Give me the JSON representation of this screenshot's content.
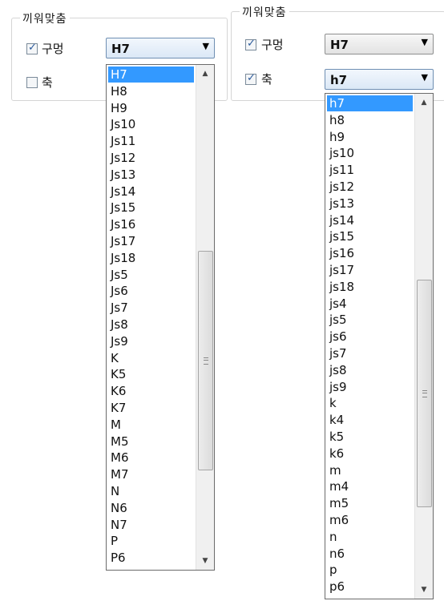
{
  "left": {
    "group_title": "끼워맞춤",
    "hole": {
      "label": "구멍",
      "checked": true
    },
    "shaft": {
      "label": "축",
      "checked": false
    },
    "combo_value": "H7",
    "items": [
      "H7",
      "H8",
      "H9",
      "Js10",
      "Js11",
      "Js12",
      "Js13",
      "Js14",
      "Js15",
      "Js16",
      "Js17",
      "Js18",
      "Js5",
      "Js6",
      "Js7",
      "Js8",
      "Js9",
      "K",
      "K5",
      "K6",
      "K7",
      "M",
      "M5",
      "M6",
      "M7",
      "N",
      "N6",
      "N7",
      "P",
      "P6"
    ],
    "selected_index": 0
  },
  "right": {
    "group_title": "끼워맞춤",
    "hole": {
      "label": "구멍",
      "checked": true
    },
    "shaft": {
      "label": "축",
      "checked": true
    },
    "hole_combo_value": "H7",
    "combo_value": "h7",
    "items": [
      "h7",
      "h8",
      "h9",
      "js10",
      "js11",
      "js12",
      "js13",
      "js14",
      "js15",
      "js16",
      "js17",
      "js18",
      "js4",
      "js5",
      "js6",
      "js7",
      "js8",
      "js9",
      "k",
      "k4",
      "k5",
      "k6",
      "m",
      "m4",
      "m5",
      "m6",
      "n",
      "n6",
      "p",
      "p6"
    ],
    "selected_index": 0
  },
  "icons": {
    "dropdown": "dropdown-arrow-icon",
    "check": "check-icon",
    "scroll_up": "scroll-up-icon",
    "scroll_down": "scroll-down-icon"
  }
}
